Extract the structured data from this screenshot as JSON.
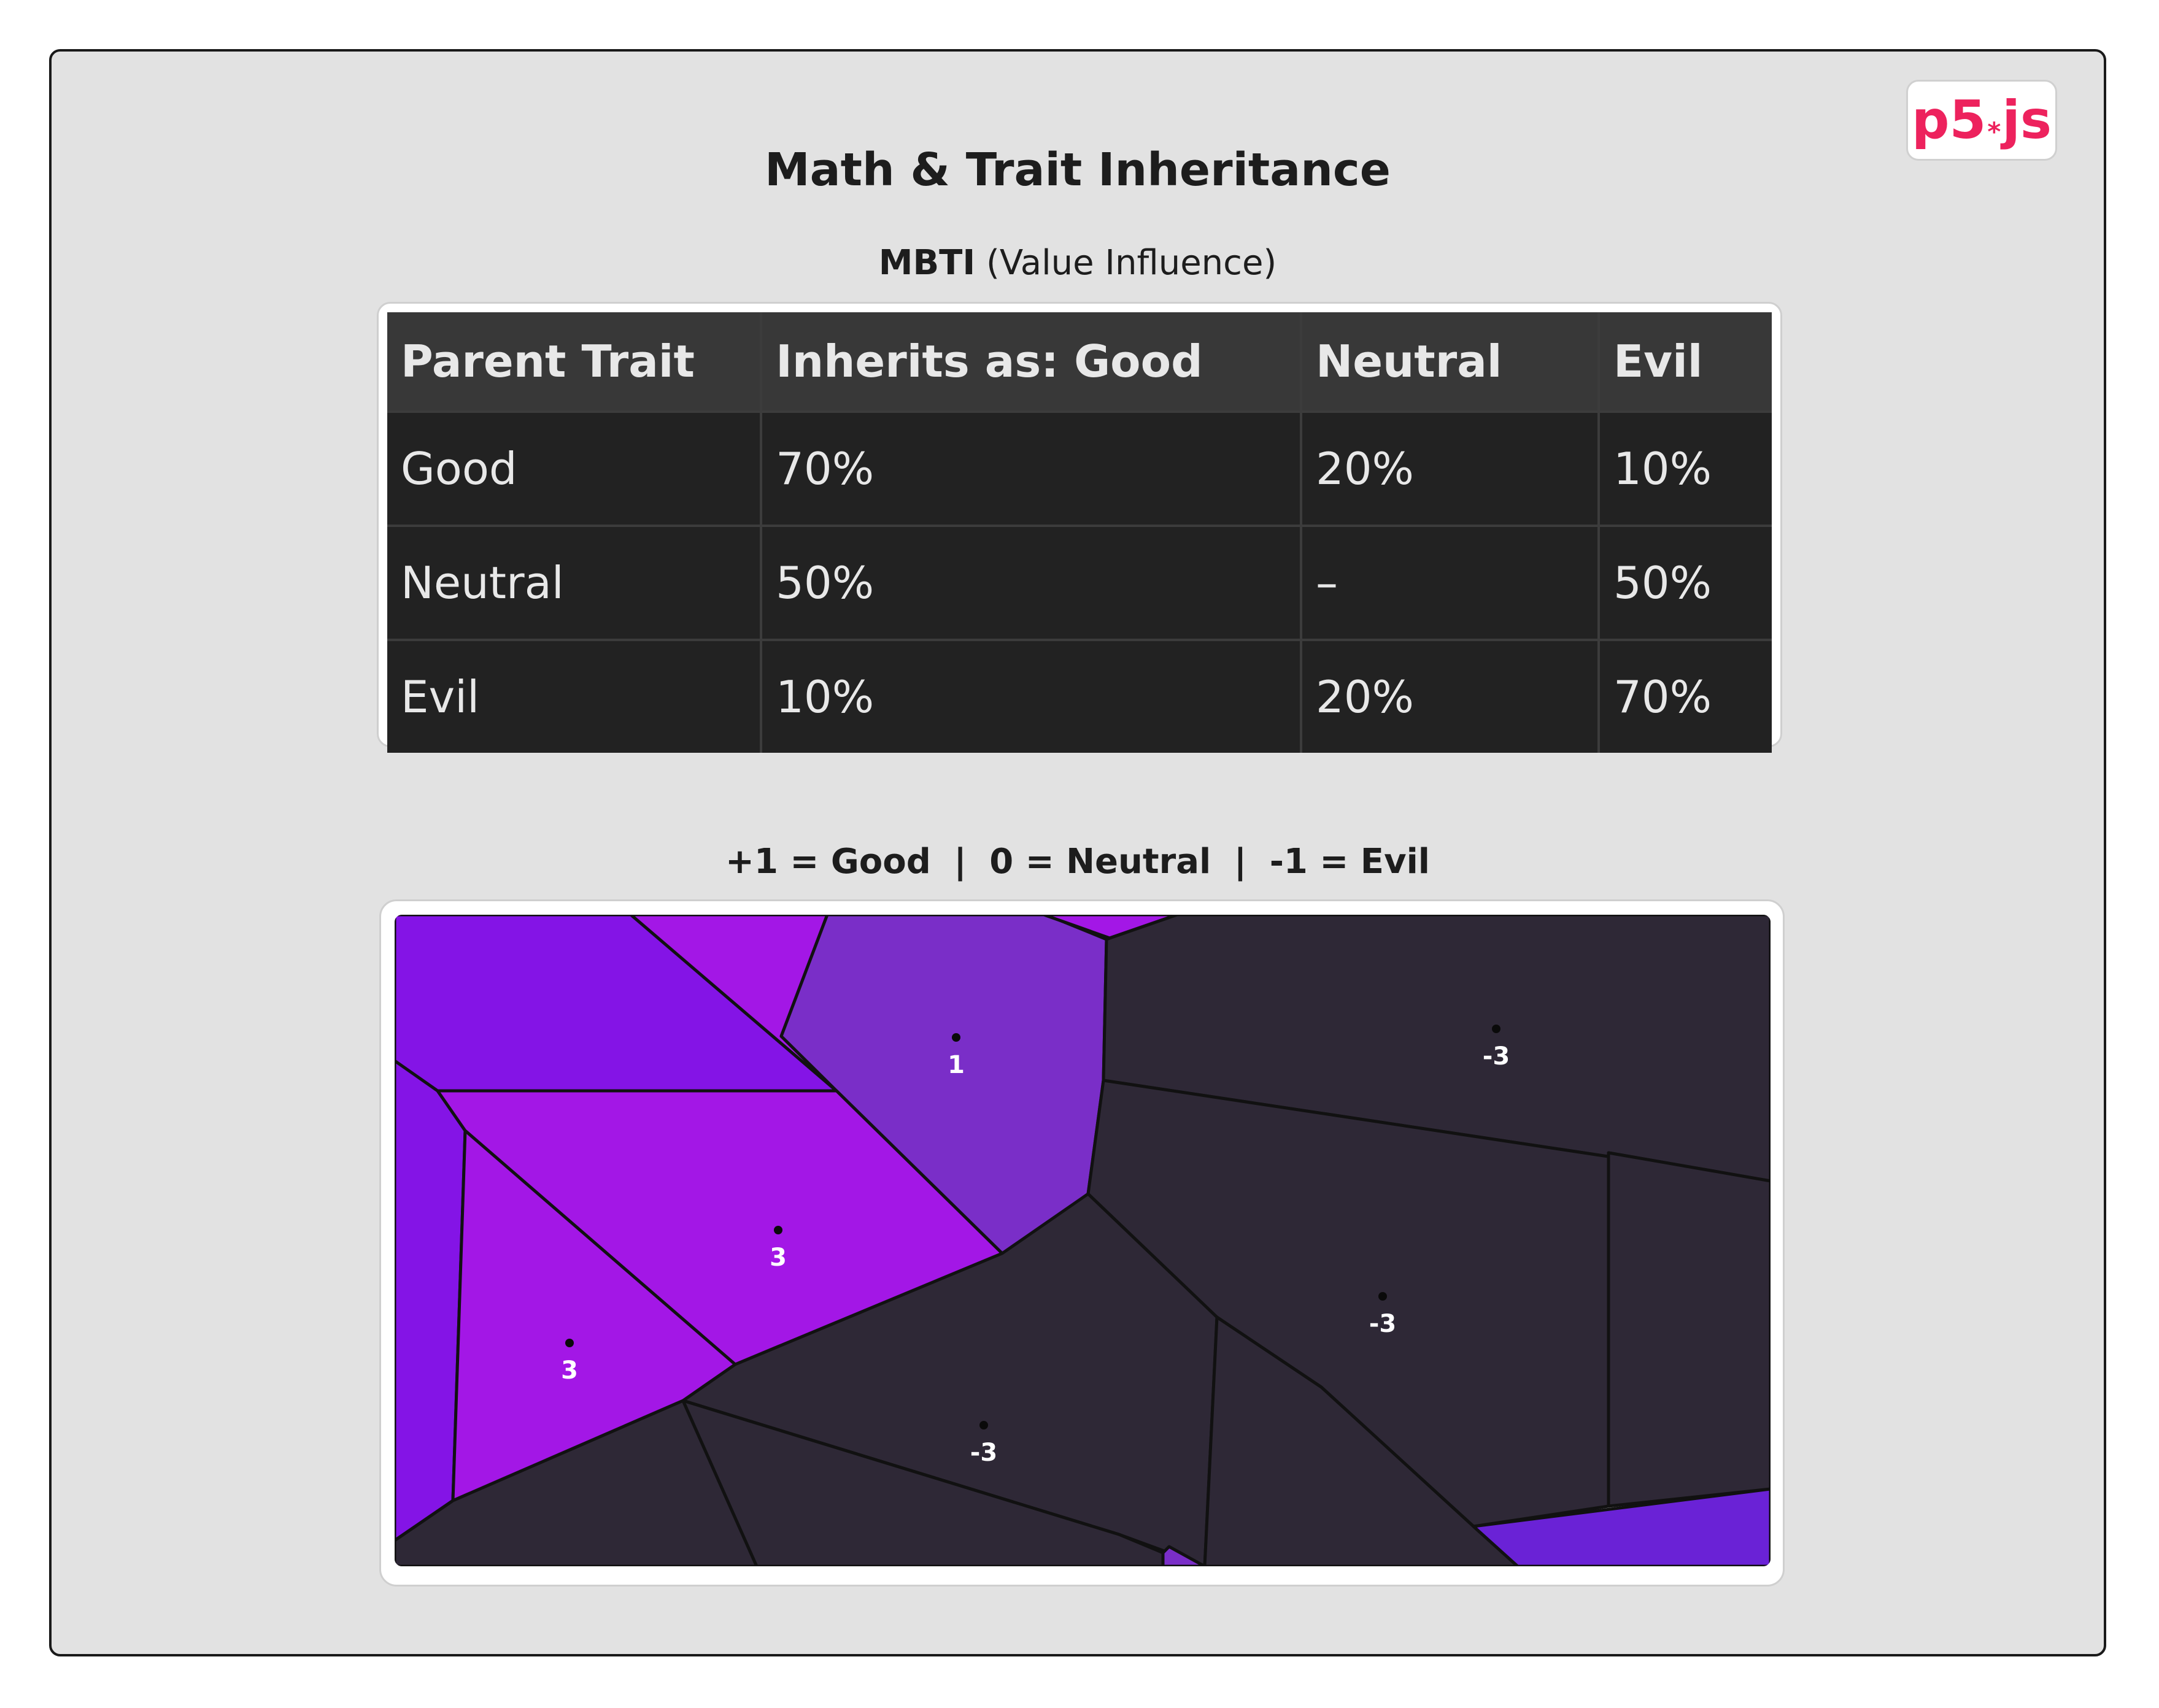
{
  "header": {
    "title": "Math & Trait Inheritance",
    "logo_text": "p5",
    "logo_star": "*",
    "logo_suffix": "js",
    "logo_color": "#ed225d"
  },
  "mbti_caption": {
    "bold": "MBTI",
    "rest": "(Value Influence)"
  },
  "table": {
    "headers": [
      "Parent Trait",
      "Inherits as: Good",
      "Neutral",
      "Evil"
    ],
    "rows": [
      [
        "Good",
        "70%",
        "20%",
        "10%"
      ],
      [
        "Neutral",
        "50%",
        "–",
        "50%"
      ],
      [
        "Evil",
        "10%",
        "20%",
        "70%"
      ]
    ]
  },
  "legend": {
    "good": "+1 = Good",
    "neutral": "0 = Neutral",
    "evil": "-1 = Evil",
    "separator": "|"
  },
  "voronoi": {
    "colors": {
      "positive": "#a317e6",
      "positive_alt": "#8414e6",
      "mid": "#7a2ec8",
      "negative": "#2e2836",
      "accent": "#6a22d6",
      "edge": "#111111"
    },
    "cells": [
      {
        "label": "1",
        "tone": "mid"
      },
      {
        "label": "-3",
        "tone": "negative"
      },
      {
        "label": "3",
        "tone": "positive"
      },
      {
        "label": "3",
        "tone": "positive"
      },
      {
        "label": "-3",
        "tone": "negative"
      },
      {
        "label": "-3",
        "tone": "negative"
      }
    ]
  }
}
